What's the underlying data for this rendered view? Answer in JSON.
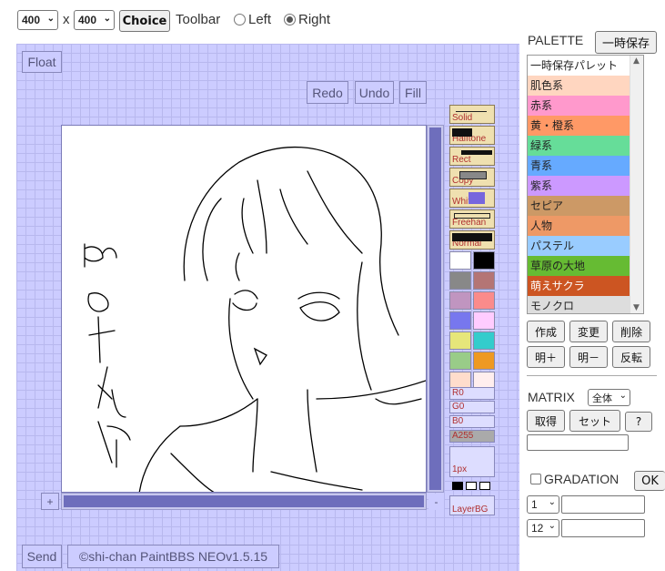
{
  "top": {
    "width_value": "400",
    "x_label": "x",
    "height_value": "400",
    "choice_label": "Choice",
    "toolbar_label": "Toolbar",
    "left_label": "Left",
    "right_label": "Right",
    "toolbar_position": "Right"
  },
  "app": {
    "float_label": "Float",
    "redo_label": "Redo",
    "undo_label": "Undo",
    "fill_label": "Fill",
    "send_label": "Send",
    "copyright": "©shi-chan PaintBBS NEOv1.5.15",
    "zoom_plus": "+",
    "zoom_minus": "-"
  },
  "tools": [
    "Solid",
    "Halftone",
    "Rect",
    "Copy",
    "White",
    "Freehan",
    "Normal"
  ],
  "swatches": [
    [
      "#ffffff",
      "#000000"
    ],
    [
      "#888888",
      "#b47575"
    ],
    [
      "#c095c0",
      "#fa8b8b"
    ],
    [
      "#7777ee",
      "#ffccff"
    ],
    [
      "#e6e67a",
      "#33cccc"
    ],
    [
      "#99cc88",
      "#ee9922"
    ],
    [
      "#ffddcc",
      "#ffeeee"
    ]
  ],
  "sliders": [
    "R0",
    "G0",
    "B0",
    "A255"
  ],
  "pen_size": "1px",
  "layer_label": "LayerBG",
  "palette": {
    "title": "PALETTE",
    "save_temp_label": "一時保存",
    "items": [
      {
        "label": "一時保存パレット",
        "color": "#ffffff"
      },
      {
        "label": "肌色系",
        "color": "#ffd6c0"
      },
      {
        "label": "赤系",
        "color": "#ff99cc"
      },
      {
        "label": "黄・橙系",
        "color": "#ff9966"
      },
      {
        "label": "緑系",
        "color": "#66dd99"
      },
      {
        "label": "青系",
        "color": "#66aaff"
      },
      {
        "label": "紫系",
        "color": "#cc99ff"
      },
      {
        "label": "セピア",
        "color": "#cc9966"
      },
      {
        "label": "人物",
        "color": "#ee9966"
      },
      {
        "label": "パステル",
        "color": "#99ccff"
      },
      {
        "label": "草原の大地",
        "color": "#66bb33"
      },
      {
        "label": "萌えサクラ",
        "color": "#cc5522"
      },
      {
        "label": "モノクロ",
        "color": "#dddddd"
      }
    ],
    "buttons": [
      "作成",
      "変更",
      "削除",
      "明＋",
      "明－",
      "反転"
    ]
  },
  "matrix": {
    "title": "MATRIX",
    "select_value": "全体",
    "get_label": "取得",
    "set_label": "セット",
    "help_label": "?"
  },
  "gradation": {
    "title": "GRADATION",
    "ok_label": "OK",
    "select1_value": "1",
    "select2_value": "12"
  }
}
